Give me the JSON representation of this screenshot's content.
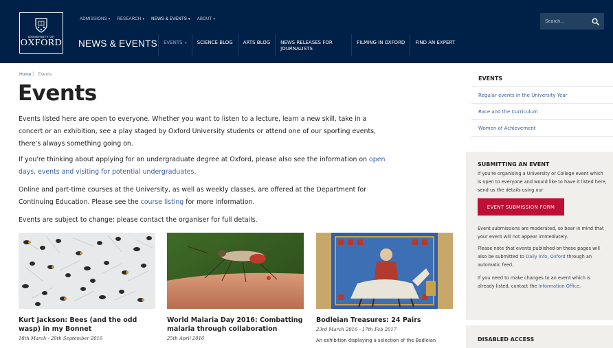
{
  "header": {
    "logo": {
      "small": "UNIVERSITY OF",
      "main": "OXFORD"
    },
    "top_nav": [
      {
        "label": "ADMISSIONS",
        "active": false
      },
      {
        "label": "RESEARCH",
        "active": false
      },
      {
        "label": "NEWS & EVENTS",
        "active": true
      },
      {
        "label": "ABOUT",
        "active": false
      }
    ],
    "section_title": "NEWS & EVENTS",
    "sub_nav": [
      {
        "label": "EVENTS",
        "has_caret": true,
        "active": true
      },
      {
        "label": "SCIENCE BLOG",
        "has_caret": false,
        "active": false
      },
      {
        "label": "ARTS BLOG",
        "has_caret": false,
        "active": false
      },
      {
        "label": "NEWS RELEASES FOR JOURNALISTS",
        "has_caret": false,
        "active": false
      },
      {
        "label": "FILMING IN OXFORD",
        "has_caret": false,
        "active": false
      },
      {
        "label": "FIND AN EXPERT",
        "has_caret": false,
        "active": false
      }
    ],
    "search": {
      "placeholder": "Search...",
      "icon": "search-icon"
    }
  },
  "breadcrumb": {
    "home": "Home",
    "separator": "〉",
    "current": "Events"
  },
  "page_title": "Events",
  "intro": {
    "p1": "Events listed here are open to everyone. Whether you want to listen to a lecture, learn a new skill, take in a concert or an exhibition, see a play staged by Oxford University students or attend one of our sporting events, there's always something going on.",
    "p2_before": "If you're thinking about applying for an undergraduate degree at Oxford, please also see the information on ",
    "p2_link": "open days, events and visiting for potential undergraduates",
    "p2_after": ".",
    "p3_before": "Online and part-time courses at the University, as well as weekly classes, are offered at the Department for Continuing Education. Please see the ",
    "p3_link": "course listing",
    "p3_after": " for more information.",
    "p4": "Events are subject to change; please contact the organiser for full details."
  },
  "cards": [
    {
      "title": "Kurt Jackson: Bees (and the odd wasp) in my Bonnet",
      "date": "18th March - 29th September 2016",
      "description": ""
    },
    {
      "title": "World Malaria Day 2016: Combatting malaria through collaboration",
      "date": "25th April 2016",
      "description": ""
    },
    {
      "title": "Bodleian Treasures: 24 Pairs",
      "date": "23rd March 2016 - 17th Feb 2017",
      "description": "An exhibition displaying a selection of the Bodleian"
    }
  ],
  "sidebar": {
    "events_heading": "EVENTS",
    "events_links": [
      "Regular events in the University Year",
      "Race and the Curriculum",
      "Women of Achievement"
    ],
    "submitting": {
      "heading": "SUBMITTING AN EVENT",
      "intro": "If you're organising a University or College event which is open to everyone and would like to have it listed here, send us the details using our",
      "button": "EVENT SUBMISSION FORM",
      "moderated": "Event submissions are moderated, so bear in mind that your event will not appear immediately.",
      "note_before": "Please note that events published on these pages will also be submitted to ",
      "note_link": "Daily Info, Oxford",
      "note_after": " through an automatic feed.",
      "change_before": "If you need to make changes to an event which is already listed, contact the ",
      "change_link": "Information Office",
      "change_after": "."
    },
    "disabled_access_heading": "DISABLED ACCESS"
  },
  "colors": {
    "header_bg": "#002147",
    "link": "#3a5e9c",
    "button_red": "#be0f34",
    "sidebar_box_bg": "#f1efec"
  }
}
